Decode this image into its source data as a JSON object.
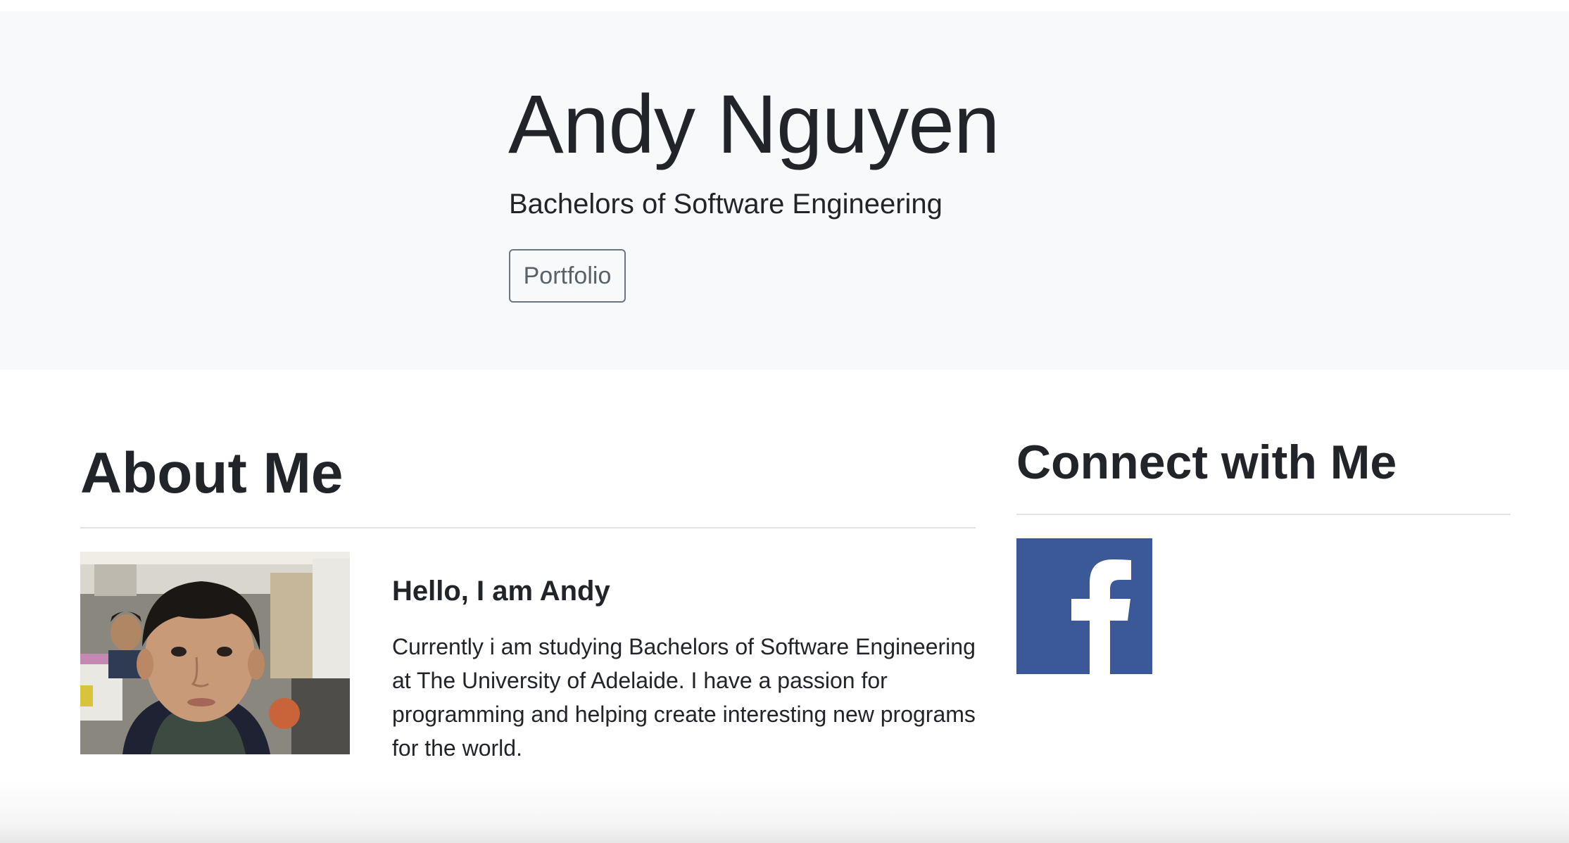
{
  "hero": {
    "title": "Andy Nguyen",
    "subtitle": "Bachelors of Software Engineering",
    "portfolio_button": "Portfolio"
  },
  "about": {
    "heading": "About Me",
    "greeting": "Hello, I am Andy",
    "text": "Currently i am studying Bachelors of Software Engineering at The University of Adelaide. I have a passion for programming and helping create interesting new programs for the world."
  },
  "connect": {
    "heading": "Connect with Me",
    "icons": [
      "facebook-icon"
    ]
  },
  "colors": {
    "hero_background": "#f8f9fa",
    "text": "#212529",
    "button_border": "#6c757d",
    "facebook_blue": "#3b5998"
  }
}
